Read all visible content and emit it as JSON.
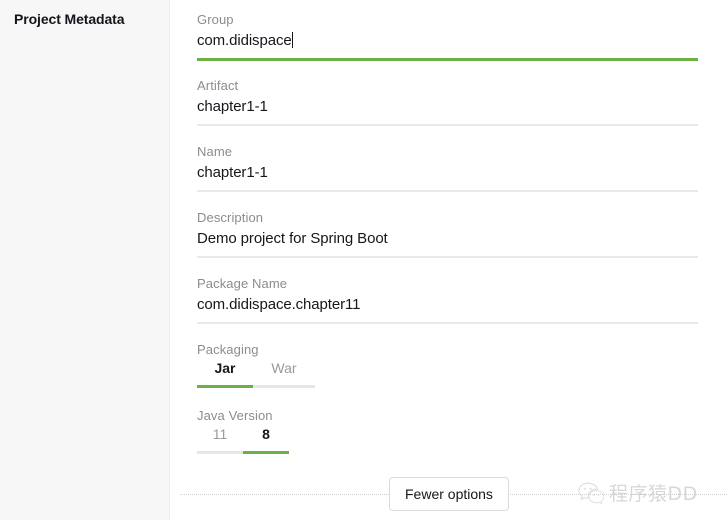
{
  "sidebar": {
    "section_title": "Project Metadata"
  },
  "form": {
    "fields": [
      {
        "label": "Group",
        "value": "com.didispace",
        "focused": true,
        "has_caret": true
      },
      {
        "label": "Artifact",
        "value": "chapter1-1",
        "focused": false,
        "has_caret": false
      },
      {
        "label": "Name",
        "value": "chapter1-1",
        "focused": false,
        "has_caret": false
      },
      {
        "label": "Description",
        "value": "Demo project for Spring Boot",
        "focused": false,
        "has_caret": false
      },
      {
        "label": "Package Name",
        "value": "com.didispace.chapter11",
        "focused": false,
        "has_caret": false
      }
    ],
    "choice_rows": [
      {
        "label": "Packaging",
        "options": [
          {
            "text": "Jar",
            "selected": true,
            "width": 56
          },
          {
            "text": "War",
            "selected": false,
            "width": 62
          }
        ]
      },
      {
        "label": "Java Version",
        "options": [
          {
            "text": "11",
            "selected": false,
            "width": 46
          },
          {
            "text": "8",
            "selected": true,
            "width": 46
          }
        ]
      }
    ]
  },
  "footer": {
    "fewer_options_label": "Fewer options"
  },
  "watermark": {
    "icon": "wechat-icon",
    "text": "程序猿DD"
  },
  "colors": {
    "accent_green": "#69b145",
    "label_gray": "#8c8c8c",
    "value_dark": "#15171c",
    "rule_gray": "#e9e9e9",
    "sidebar_bg": "#f7f7f7"
  }
}
